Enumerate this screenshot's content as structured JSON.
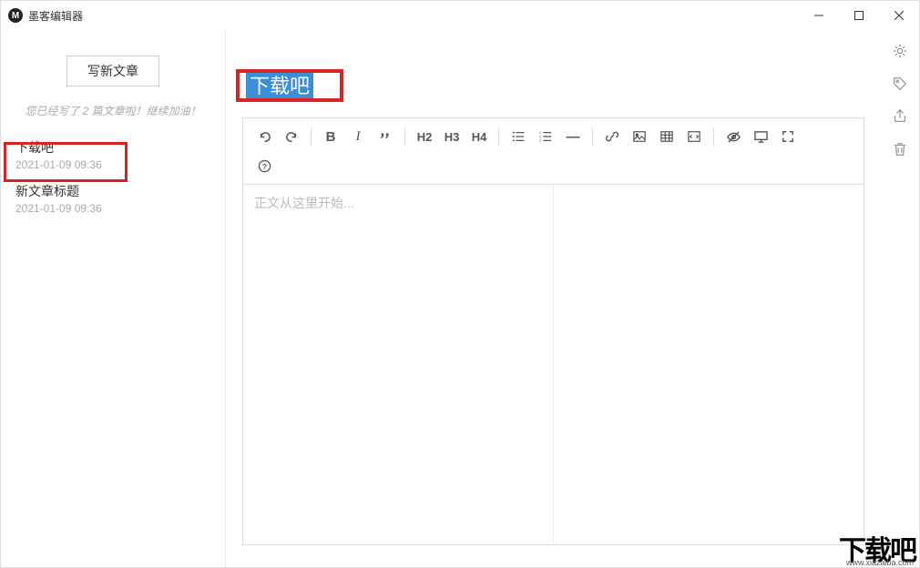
{
  "window": {
    "title": "墨客编辑器"
  },
  "sidebar": {
    "new_article_label": "写新文章",
    "stats_text": "您已经写了 2 篇文章啦！继续加油！",
    "items": [
      {
        "title": "下载吧",
        "date": "2021-01-09 09:36"
      },
      {
        "title": "新文章标题",
        "date": "2021-01-09 09:36"
      }
    ]
  },
  "editor": {
    "title": "下载吧",
    "placeholder": "正文从这里开始..."
  },
  "toolbar": {
    "undo": "↶",
    "redo": "↷",
    "bold": "B",
    "italic": "I",
    "quote": "❝",
    "h2": "H2",
    "h3": "H3",
    "h4": "H4",
    "ul": "≣",
    "ol": "≡",
    "hr": "—",
    "link": "🔗",
    "image": "🖼",
    "table": "▦",
    "code": "⌘",
    "preview": "👁",
    "fullscreen": "🖵",
    "expand": "⛶",
    "help": "?"
  },
  "rail": {
    "settings": "gear",
    "tag": "tag",
    "share": "share",
    "trash": "trash"
  },
  "watermark": {
    "main": "下载吧",
    "sub": "www.xiazaiba.com"
  }
}
